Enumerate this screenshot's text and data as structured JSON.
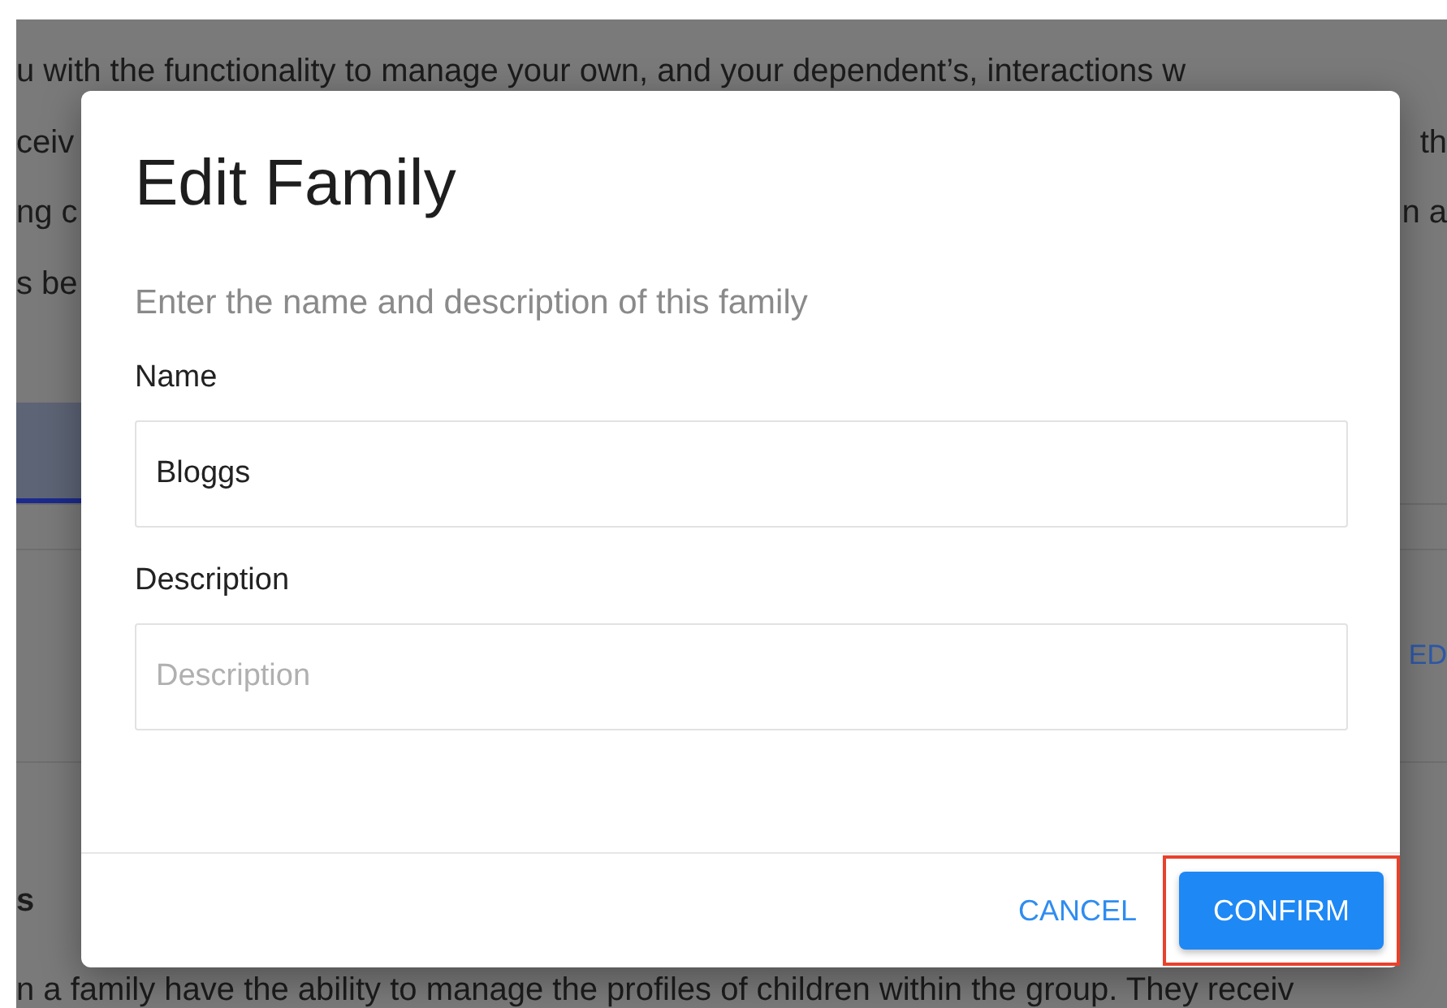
{
  "background_page": {
    "lines": [
      {
        "left": "u with the functionality to manage your own, and your dependent’s, interactions w"
      },
      {
        "left": "ceiv",
        "right": "th"
      },
      {
        "left": "ng c",
        "right": "n a"
      },
      {
        "left": "s be"
      }
    ],
    "link": "ED",
    "heading": "s",
    "footer_text": "n a family have the ability to manage the profiles of children within the group. They receiv"
  },
  "dialog": {
    "title": "Edit Family",
    "subtitle": "Enter the name and description of this family",
    "fields": [
      {
        "label": "Name",
        "value": "Bloggs"
      },
      {
        "label": "Description",
        "placeholder": "Description"
      }
    ],
    "buttons": [
      {
        "label": "CANCEL",
        "kind": "text",
        "highlighted": false
      },
      {
        "label": "CONFIRM",
        "kind": "primary",
        "highlighted": true
      }
    ]
  }
}
